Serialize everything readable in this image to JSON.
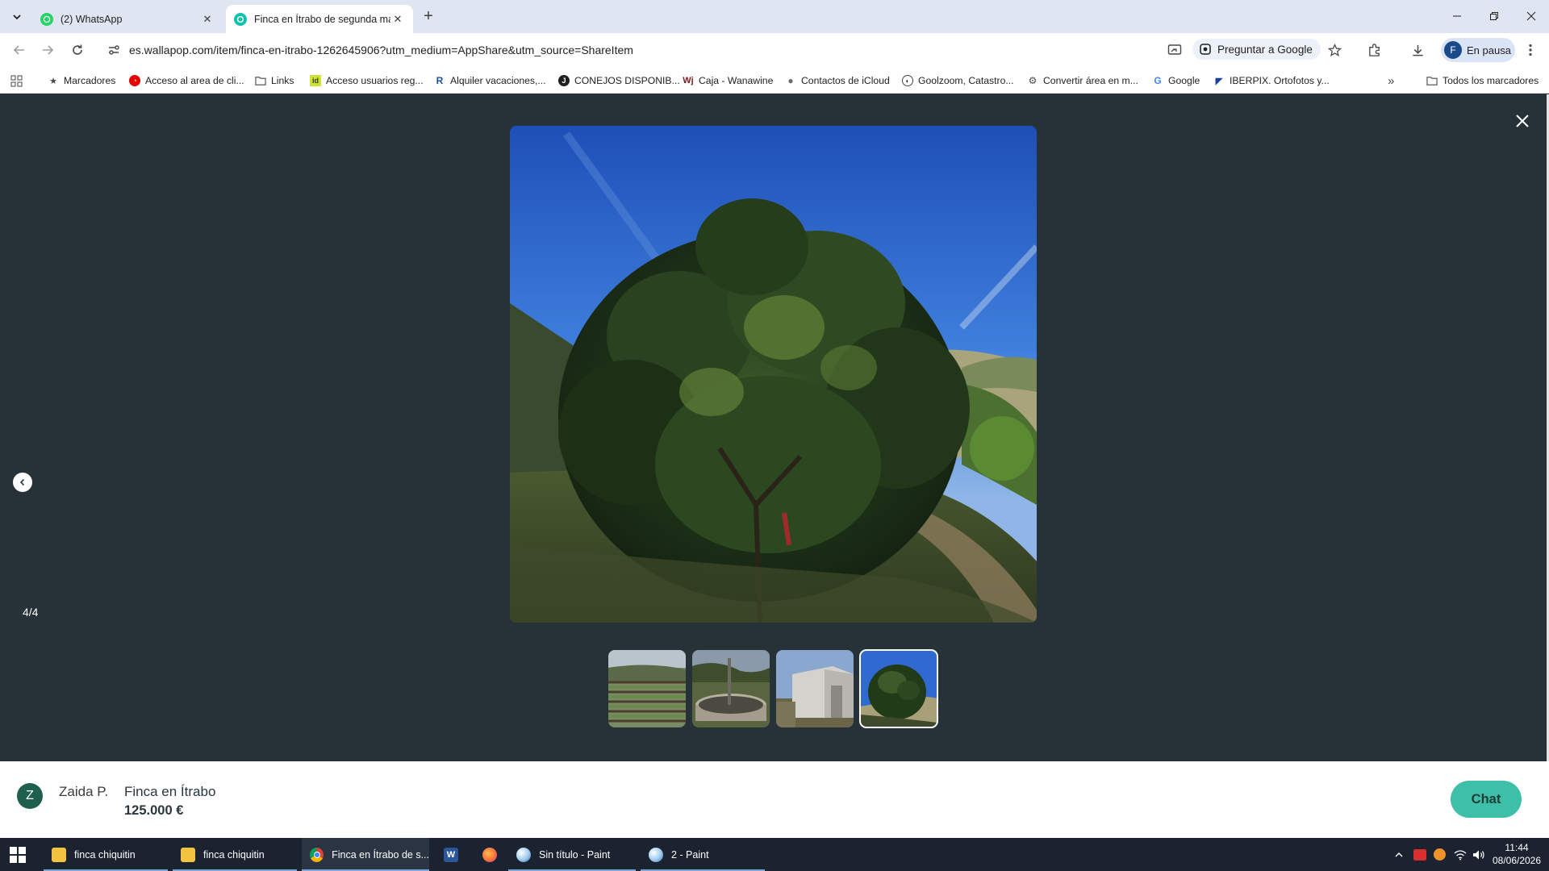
{
  "browser": {
    "tabs": [
      {
        "title": "(2) WhatsApp",
        "active": false,
        "favicon": "whatsapp-icon"
      },
      {
        "title": "Finca en Ítrabo de segunda ma",
        "active": true,
        "favicon": "wallapop-icon"
      }
    ],
    "url": "es.wallapop.com/item/finca-en-itrabo-1262645906?utm_medium=AppShare&utm_source=ShareItem",
    "ask_google_label": "Preguntar a Google",
    "profile_label": "En pausa",
    "profile_initial": "F",
    "bookmarks": [
      {
        "label": "Marcadores",
        "icon": "star-icon"
      },
      {
        "label": "Acceso al area de cli...",
        "icon": "vodafone-icon"
      },
      {
        "label": "Links",
        "icon": "folder-icon"
      },
      {
        "label": "Acceso usuarios reg...",
        "icon": "idealista-icon"
      },
      {
        "label": "Alquiler vacaciones,...",
        "icon": "r-icon"
      },
      {
        "label": "CONEJOS DISPONIB...",
        "icon": "j-icon"
      },
      {
        "label": "Caja - Wanawine",
        "icon": "wanawine-icon"
      },
      {
        "label": "Contactos de iCloud",
        "icon": "apple-icon"
      },
      {
        "label": "Goolzoom, Catastro...",
        "icon": "goolzoom-icon"
      },
      {
        "label": "Convertir área en m...",
        "icon": "convert-icon"
      },
      {
        "label": "Google",
        "icon": "google-icon"
      },
      {
        "label": "IBERPIX. Ortofotos y...",
        "icon": "iberpix-icon"
      }
    ],
    "all_bookmarks_label": "Todos los marcadores"
  },
  "viewer": {
    "counter": "4/4",
    "thumbnails": [
      {
        "name": "thumbnail-terraces",
        "selected": false
      },
      {
        "name": "thumbnail-water-tank",
        "selected": false
      },
      {
        "name": "thumbnail-building",
        "selected": false
      },
      {
        "name": "thumbnail-avocado-tree",
        "selected": true
      }
    ]
  },
  "listing": {
    "seller_initial": "Z",
    "seller_name": "Zaida P.",
    "title": "Finca en Ítrabo",
    "price": "125.000 €",
    "chat_label": "Chat"
  },
  "taskbar": {
    "apps": [
      {
        "label": "finca chiquitin",
        "icon": "folder-icon"
      },
      {
        "label": "finca chiquitin",
        "icon": "folder-icon"
      },
      {
        "label": "Finca en Ítrabo de s...",
        "icon": "chrome-icon"
      },
      {
        "label": "",
        "icon": "word-icon"
      },
      {
        "label": "",
        "icon": "firefox-icon"
      },
      {
        "label": "Sin título - Paint",
        "icon": "paint-icon"
      },
      {
        "label": "2 - Paint",
        "icon": "paint-icon"
      }
    ],
    "time": "11:44",
    "date": "08/06/2026"
  },
  "colors": {
    "viewer_bg": "#273238",
    "accent": "#3ebfa7",
    "tabbar_bg": "#dfe6f2",
    "taskbar_bg": "#1b2330"
  }
}
